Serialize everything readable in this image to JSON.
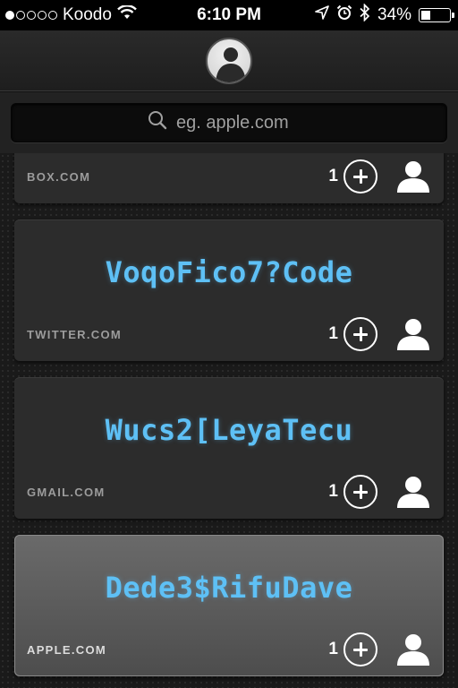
{
  "status_bar": {
    "carrier": "Koodo",
    "signal_filled": 1,
    "signal_total": 5,
    "time": "6:10 PM",
    "battery_text": "34%",
    "battery_level": 0.34,
    "icons": [
      "wifi-icon",
      "location-icon",
      "alarm-icon",
      "bluetooth-icon",
      "battery-icon"
    ]
  },
  "header": {
    "avatar_icon": "user-avatar"
  },
  "search": {
    "placeholder": "eg. apple.com",
    "value": ""
  },
  "cards": [
    {
      "password": "",
      "domain": "BOX.COM",
      "count": "1",
      "selected": false
    },
    {
      "password": "VoqoFico7?Code",
      "domain": "TWITTER.COM",
      "count": "1",
      "selected": false
    },
    {
      "password": "Wucs2[LeyaTecu",
      "domain": "GMAIL.COM",
      "count": "1",
      "selected": false
    },
    {
      "password": "Dede3$RifuDave",
      "domain": "APPLE.COM",
      "count": "1",
      "selected": true
    }
  ],
  "colors": {
    "password_text": "#5ec0f5",
    "card_bg": "#2c2c2c",
    "card_selected_bg": "#5a5a5a"
  }
}
